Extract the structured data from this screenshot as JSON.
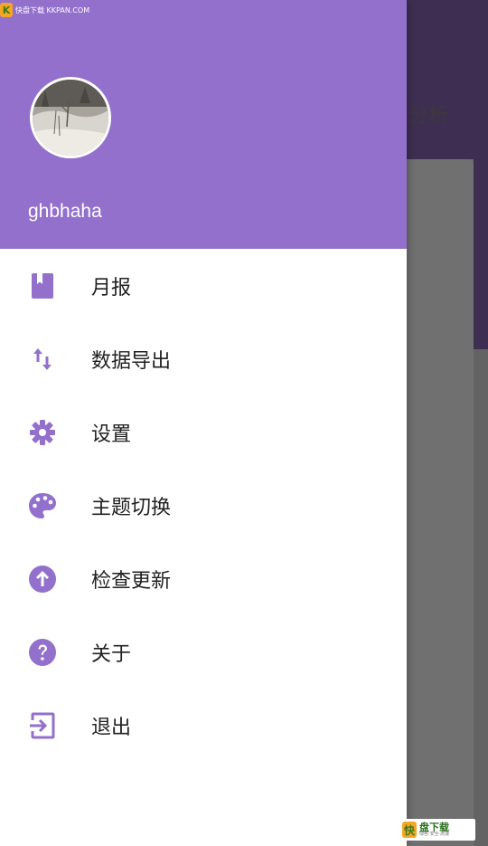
{
  "background": {
    "title_fragment": "分析"
  },
  "watermark": {
    "top_text": "快盘下载 KKPAN.COM",
    "top_logo": "K",
    "bottom_glyph": "快",
    "bottom_title": "盘下载",
    "bottom_sub": "绿色·安全·高速"
  },
  "drawer": {
    "header_color": "#9370cc",
    "icon_color": "#9370cc",
    "username": "ghbhaha",
    "items": [
      {
        "label": "月报",
        "icon": "bookmark-book-icon"
      },
      {
        "label": "数据导出",
        "icon": "swap-vert-icon"
      },
      {
        "label": "设置",
        "icon": "gear-icon"
      },
      {
        "label": "主题切换",
        "icon": "palette-icon"
      },
      {
        "label": "检查更新",
        "icon": "arrow-up-circle-icon"
      },
      {
        "label": "关于",
        "icon": "help-circle-icon"
      },
      {
        "label": "退出",
        "icon": "exit-icon"
      }
    ]
  }
}
